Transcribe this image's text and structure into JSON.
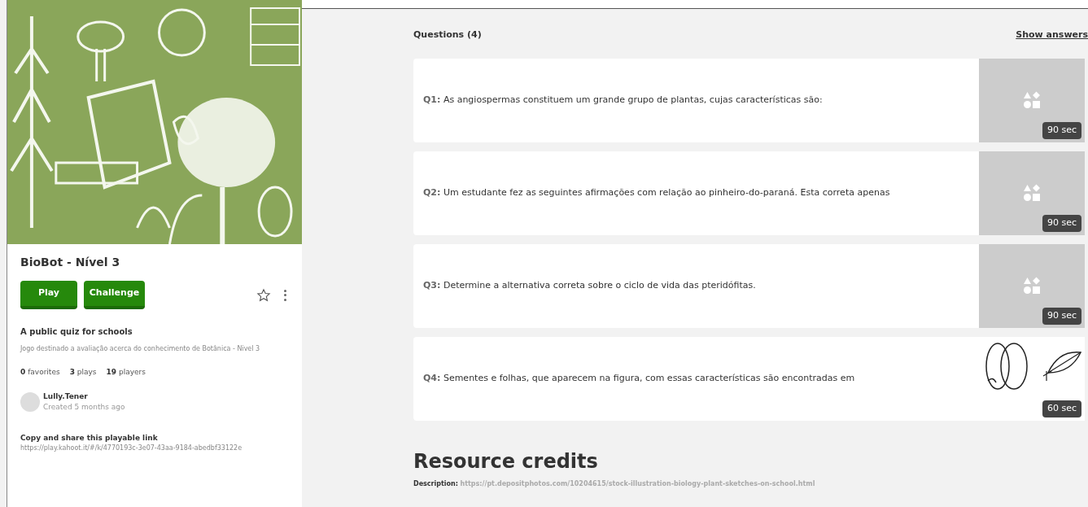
{
  "quiz": {
    "title": "BioBot - Nível 3",
    "buttons": [
      "Play",
      "Challenge"
    ],
    "favorite": {
      "selected": false
    },
    "subtitle": "A public quiz for schools",
    "description": "Jogo destinado a avaliação acerca do conhecimento de Botânica - Nivel 3",
    "stats": [
      {
        "count": "0",
        "label": "favorites"
      },
      {
        "count": "3",
        "label": "plays"
      },
      {
        "count": "19",
        "label": "players"
      }
    ],
    "author": {
      "name": "Lully.Tener",
      "created": "Created 5 months ago"
    },
    "share": {
      "title": "Copy and share this playable link",
      "link": "https://play.kahoot.it/#/k/4770193c-3e07-43aa-9184-abedbf33122e"
    }
  },
  "questions_header": {
    "title": "Questions (4)",
    "action": "Show answers"
  },
  "questions": [
    {
      "number": "Q1:",
      "text": "As angiospermas constituem um grande grupo de plantas, cujas características são:",
      "kind": "placeholder",
      "time": "90 sec"
    },
    {
      "number": "Q2:",
      "text": "Um estudante fez as seguintes afirmações com relação ao pinheiro-do-paraná. Esta correta apenas",
      "kind": "placeholder",
      "time": "90 sec"
    },
    {
      "number": "Q3:",
      "text": "Determine a alternativa correta sobre o ciclo de vida das pteridófitas.",
      "kind": "placeholder",
      "time": "90 sec"
    },
    {
      "number": "Q4:",
      "text": "Sementes e folhas, que aparecem na figura, com essas características são encontradas em",
      "time": "60 sec"
    }
  ],
  "credits": {
    "title": "Resource credits",
    "label": "Description:",
    "link": "https://pt.depositphotos.com/10204615/stock-illustration-biology-plant-sketches-on-school.html"
  }
}
